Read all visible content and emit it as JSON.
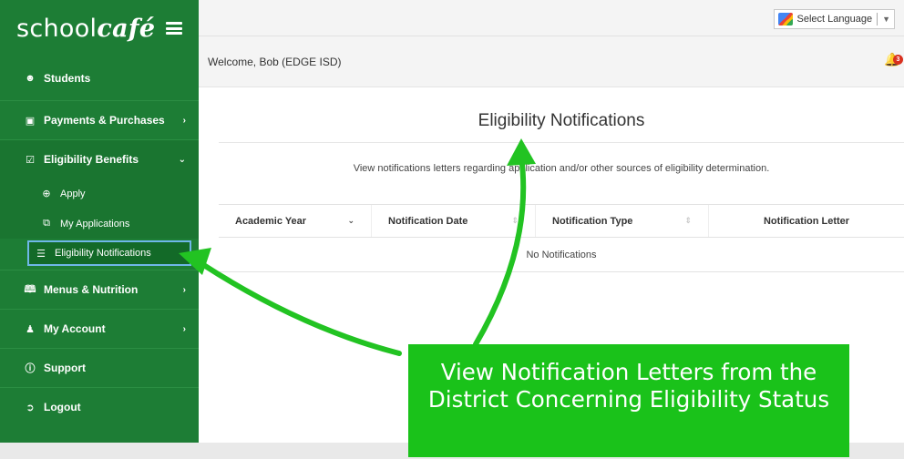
{
  "app": {
    "logo_prefix": "school",
    "logo_script": "café"
  },
  "sidebar": {
    "items": [
      {
        "label": "Students",
        "icon": "users-icon"
      },
      {
        "label": "Payments & Purchases",
        "icon": "money-icon",
        "chevron": "›"
      },
      {
        "label": "Eligibility Benefits",
        "icon": "check-square-icon",
        "chevron": "⌄",
        "children": [
          {
            "label": "Apply",
            "icon": "plus-circle-icon"
          },
          {
            "label": "My Applications",
            "icon": "copy-icon"
          },
          {
            "label": "Eligibility Notifications",
            "icon": "list-icon"
          }
        ]
      },
      {
        "label": "Menus & Nutrition",
        "icon": "book-icon",
        "chevron": "›"
      },
      {
        "label": "My Account",
        "icon": "user-icon",
        "chevron": "›"
      },
      {
        "label": "Support",
        "icon": "info-icon"
      },
      {
        "label": "Logout",
        "icon": "sign-out-icon"
      }
    ]
  },
  "topbar": {
    "language_label": "Select Language",
    "language_arrow": "▼"
  },
  "header": {
    "welcome": "Welcome, Bob (EDGE ISD)",
    "notification_count": "3"
  },
  "main": {
    "title": "Eligibility Notifications",
    "description": "View notifications letters regarding application and/or other sources of eligibility determination.",
    "table": {
      "columns": [
        "Academic Year",
        "Notification Date",
        "Notification Type",
        "Notification Letter"
      ],
      "empty_text": "No Notifications"
    }
  },
  "callout": {
    "text": "View Notification Letters from the District Concerning Eligibility Status"
  },
  "colors": {
    "sidebar_green": "#1d7d35",
    "callout_green": "#1ac21a",
    "arrow_green": "#22c322",
    "badge_red": "#d9311f"
  }
}
